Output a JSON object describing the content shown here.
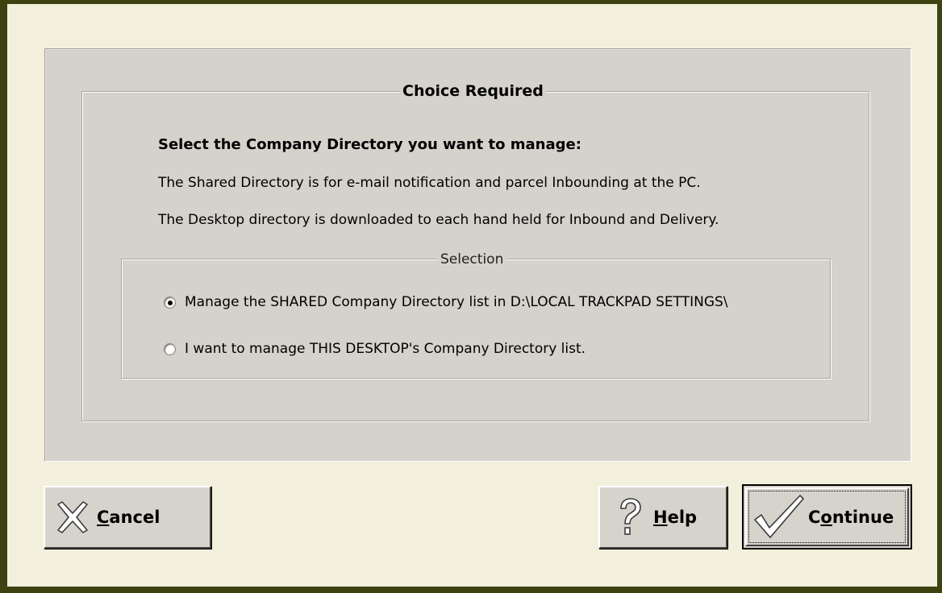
{
  "dialog": {
    "group_title": "Choice Required",
    "heading": "Select the Company Directory you want to manage:",
    "line1": "The Shared Directory is for e-mail notification and parcel Inbounding at the PC.",
    "line2": "The Desktop directory is downloaded to each hand held for Inbound and Delivery.",
    "selection": {
      "title": "Selection",
      "options": [
        {
          "label": "Manage the SHARED Company Directory list in D:\\LOCAL TRACKPAD SETTINGS\\",
          "selected": true
        },
        {
          "label": "I want to manage THIS DESKTOP's Company Directory list.",
          "selected": false
        }
      ]
    }
  },
  "buttons": {
    "cancel": {
      "accel": "C",
      "rest": "ancel",
      "icon": "x-icon"
    },
    "help": {
      "accel": "H",
      "rest": "elp",
      "icon": "question-icon"
    },
    "continue": {
      "pre": "C",
      "accel": "o",
      "rest": "ntinue",
      "icon": "checkmark-icon"
    }
  }
}
